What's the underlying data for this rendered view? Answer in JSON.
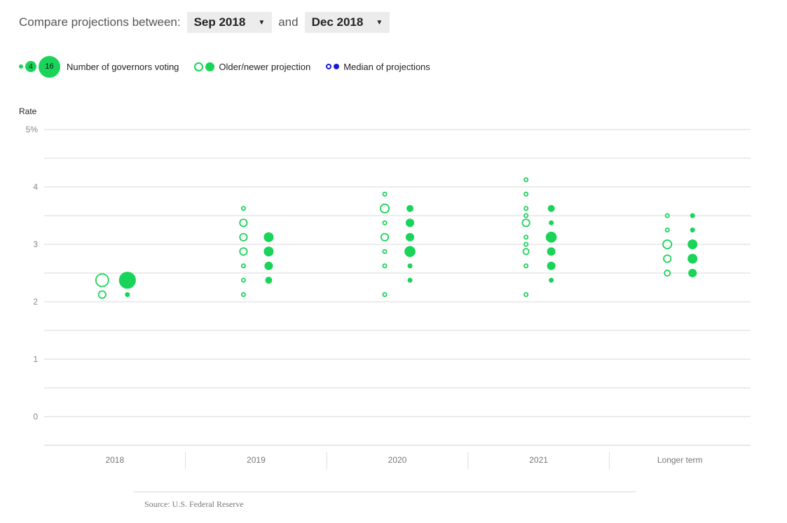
{
  "controls": {
    "prefix": "Compare projections between:",
    "older": "Sep 2018",
    "conj": "and",
    "newer": "Dec 2018"
  },
  "legend": {
    "sizes": [
      "1",
      "4",
      "16"
    ],
    "sizes_label": "Number of governors voting",
    "projection_label": "Older/newer projection",
    "median_label": "Median of projections"
  },
  "colors": {
    "green": "#1ad45a",
    "median": "#1a1ad4",
    "grid": "#d9d9d9",
    "text": "#333333"
  },
  "chart_data": {
    "type": "scatter",
    "ylabel": "Rate",
    "ylim": [
      -0.5,
      5
    ],
    "yticks": [
      0,
      1,
      2,
      3,
      4,
      5
    ],
    "ytick_labels": [
      "0",
      "1",
      "2",
      "3",
      "4",
      "5%"
    ],
    "categories": [
      "2018",
      "2019",
      "2020",
      "2021",
      "Longer term"
    ],
    "series": [
      {
        "name": "Sep 2018",
        "style": "open",
        "points": [
          {
            "cat": "2018",
            "rate": 2.375,
            "count": 8
          },
          {
            "cat": "2018",
            "rate": 2.125,
            "count": 3
          },
          {
            "cat": "2019",
            "rate": 3.625,
            "count": 1
          },
          {
            "cat": "2019",
            "rate": 3.375,
            "count": 3
          },
          {
            "cat": "2019",
            "rate": 3.125,
            "count": 3
          },
          {
            "cat": "2019",
            "rate": 2.875,
            "count": 3
          },
          {
            "cat": "2019",
            "rate": 2.625,
            "count": 1
          },
          {
            "cat": "2019",
            "rate": 2.375,
            "count": 1
          },
          {
            "cat": "2019",
            "rate": 2.125,
            "count": 1
          },
          {
            "cat": "2020",
            "rate": 3.875,
            "count": 1
          },
          {
            "cat": "2020",
            "rate": 3.625,
            "count": 4
          },
          {
            "cat": "2020",
            "rate": 3.375,
            "count": 1
          },
          {
            "cat": "2020",
            "rate": 3.125,
            "count": 3
          },
          {
            "cat": "2020",
            "rate": 2.875,
            "count": 1
          },
          {
            "cat": "2020",
            "rate": 2.625,
            "count": 1
          },
          {
            "cat": "2020",
            "rate": 2.125,
            "count": 1
          },
          {
            "cat": "2021",
            "rate": 4.125,
            "count": 1
          },
          {
            "cat": "2021",
            "rate": 3.875,
            "count": 1
          },
          {
            "cat": "2021",
            "rate": 3.625,
            "count": 1
          },
          {
            "cat": "2021",
            "rate": 3.5,
            "count": 1
          },
          {
            "cat": "2021",
            "rate": 3.375,
            "count": 3
          },
          {
            "cat": "2021",
            "rate": 3.125,
            "count": 1
          },
          {
            "cat": "2021",
            "rate": 3.0,
            "count": 1
          },
          {
            "cat": "2021",
            "rate": 2.875,
            "count": 2
          },
          {
            "cat": "2021",
            "rate": 2.625,
            "count": 1
          },
          {
            "cat": "2021",
            "rate": 2.125,
            "count": 1
          },
          {
            "cat": "Longer term",
            "rate": 3.5,
            "count": 1
          },
          {
            "cat": "Longer term",
            "rate": 3.25,
            "count": 1
          },
          {
            "cat": "Longer term",
            "rate": 3.0,
            "count": 4
          },
          {
            "cat": "Longer term",
            "rate": 2.75,
            "count": 3
          },
          {
            "cat": "Longer term",
            "rate": 2.5,
            "count": 2
          }
        ]
      },
      {
        "name": "Dec 2018",
        "style": "filled",
        "points": [
          {
            "cat": "2018",
            "rate": 2.375,
            "count": 12
          },
          {
            "cat": "2018",
            "rate": 2.125,
            "count": 1
          },
          {
            "cat": "2019",
            "rate": 3.125,
            "count": 4
          },
          {
            "cat": "2019",
            "rate": 2.875,
            "count": 4
          },
          {
            "cat": "2019",
            "rate": 2.625,
            "count": 3
          },
          {
            "cat": "2019",
            "rate": 2.375,
            "count": 2
          },
          {
            "cat": "2020",
            "rate": 3.625,
            "count": 2
          },
          {
            "cat": "2020",
            "rate": 3.375,
            "count": 3
          },
          {
            "cat": "2020",
            "rate": 3.125,
            "count": 3
          },
          {
            "cat": "2020",
            "rate": 2.875,
            "count": 5
          },
          {
            "cat": "2020",
            "rate": 2.625,
            "count": 1
          },
          {
            "cat": "2020",
            "rate": 2.375,
            "count": 1
          },
          {
            "cat": "2021",
            "rate": 3.625,
            "count": 2
          },
          {
            "cat": "2021",
            "rate": 3.375,
            "count": 1
          },
          {
            "cat": "2021",
            "rate": 3.125,
            "count": 5
          },
          {
            "cat": "2021",
            "rate": 2.875,
            "count": 3
          },
          {
            "cat": "2021",
            "rate": 2.625,
            "count": 3
          },
          {
            "cat": "2021",
            "rate": 2.375,
            "count": 1
          },
          {
            "cat": "Longer term",
            "rate": 3.5,
            "count": 1
          },
          {
            "cat": "Longer term",
            "rate": 3.25,
            "count": 1
          },
          {
            "cat": "Longer term",
            "rate": 3.0,
            "count": 4
          },
          {
            "cat": "Longer term",
            "rate": 2.75,
            "count": 4
          },
          {
            "cat": "Longer term",
            "rate": 2.5,
            "count": 3
          }
        ]
      }
    ]
  },
  "source": "Source: U.S. Federal Reserve"
}
